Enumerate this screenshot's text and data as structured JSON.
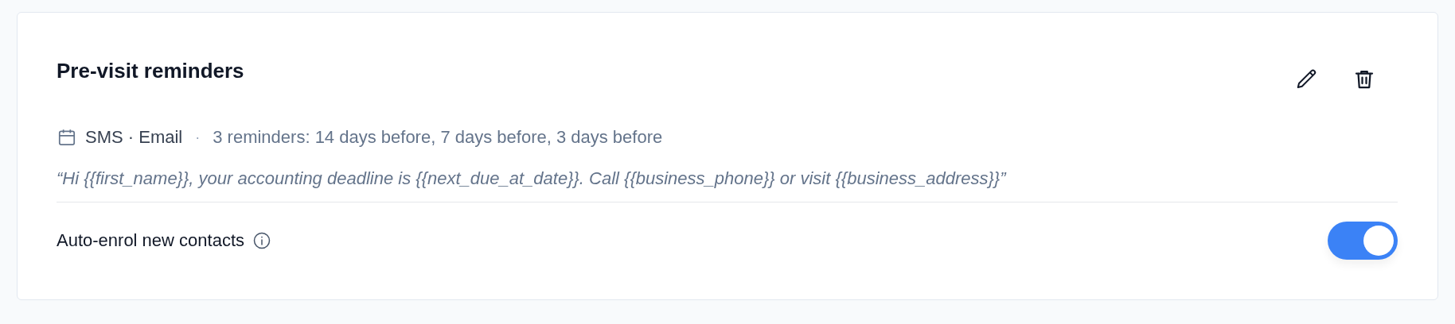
{
  "card": {
    "title": "Pre-visit reminders",
    "actions": [
      {
        "kind": "edit"
      },
      {
        "kind": "delete"
      }
    ],
    "channels": "SMS · Email",
    "separator": "·",
    "schedule": "3 reminders: 14 days before, 7 days before, 3 days before",
    "message": "“Hi {{first_name}}, your accounting deadline is {{next_due_at_date}}. Call {{business_phone}} or visit {{business_address}}”",
    "auto_enrol": {
      "label": "Auto-enrol new contacts",
      "on": true
    }
  }
}
